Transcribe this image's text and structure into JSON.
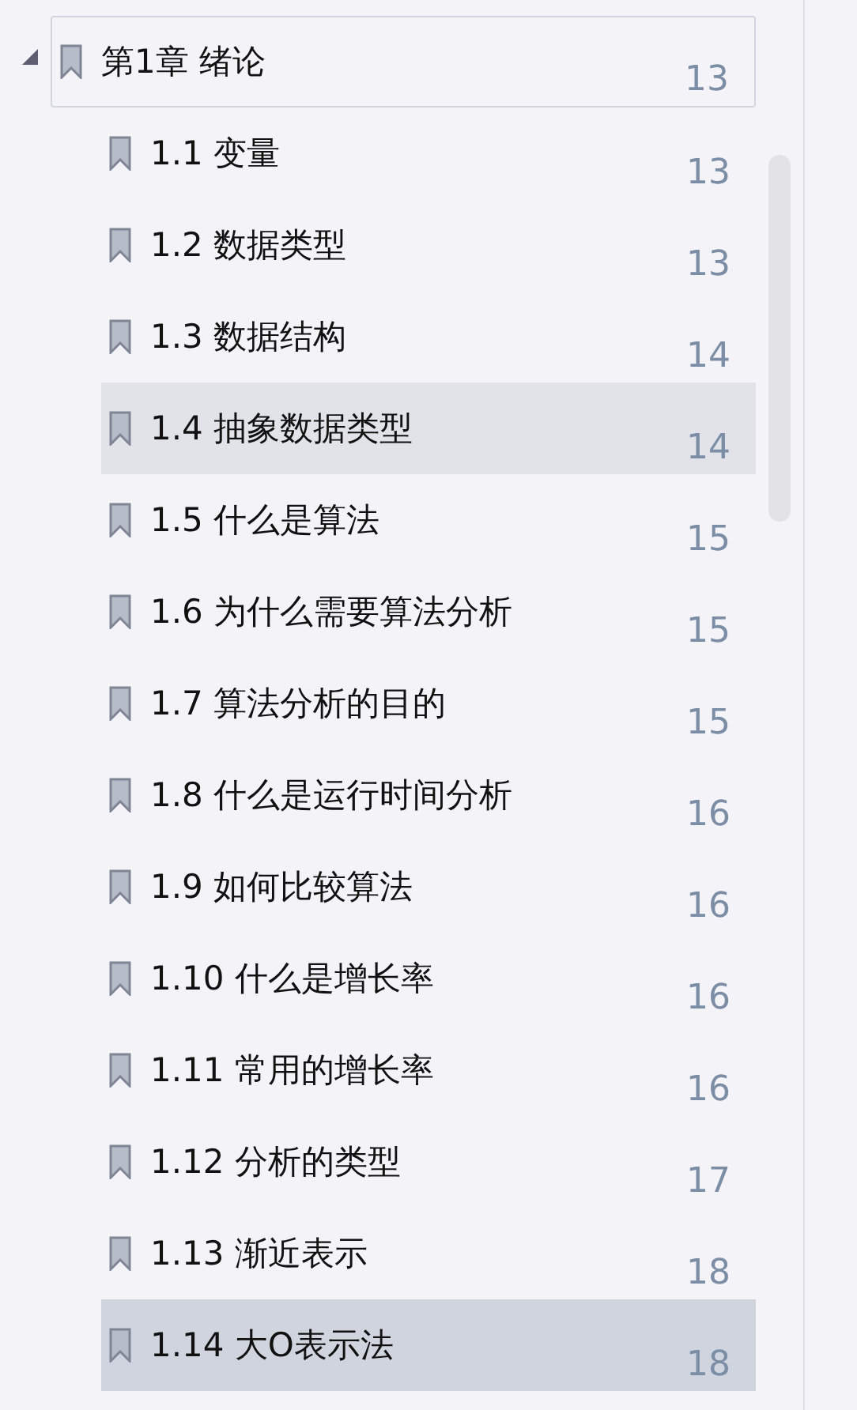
{
  "outline": {
    "chapter": {
      "title": "第1章 绪论",
      "page": "13",
      "expanded": true,
      "focused": true
    },
    "items": [
      {
        "title": "1.1 变量",
        "page": "13",
        "hovered": false,
        "selected": false
      },
      {
        "title": "1.2 数据类型",
        "page": "13",
        "hovered": false,
        "selected": false
      },
      {
        "title": "1.3 数据结构",
        "page": "14",
        "hovered": false,
        "selected": false
      },
      {
        "title": "1.4 抽象数据类型",
        "page": "14",
        "hovered": true,
        "selected": false
      },
      {
        "title": "1.5 什么是算法",
        "page": "15",
        "hovered": false,
        "selected": false
      },
      {
        "title": "1.6 为什么需要算法分析",
        "page": "15",
        "hovered": false,
        "selected": false
      },
      {
        "title": "1.7 算法分析的目的",
        "page": "15",
        "hovered": false,
        "selected": false
      },
      {
        "title": "1.8 什么是运行时间分析",
        "page": "16",
        "hovered": false,
        "selected": false
      },
      {
        "title": "1.9 如何比较算法",
        "page": "16",
        "hovered": false,
        "selected": false
      },
      {
        "title": "1.10 什么是增长率",
        "page": "16",
        "hovered": false,
        "selected": false
      },
      {
        "title": "1.11 常用的增长率",
        "page": "16",
        "hovered": false,
        "selected": false
      },
      {
        "title": "1.12 分析的类型",
        "page": "17",
        "hovered": false,
        "selected": false
      },
      {
        "title": "1.13 渐近表示",
        "page": "18",
        "hovered": false,
        "selected": false
      },
      {
        "title": "1.14 大O表示法",
        "page": "18",
        "hovered": false,
        "selected": true
      }
    ]
  }
}
